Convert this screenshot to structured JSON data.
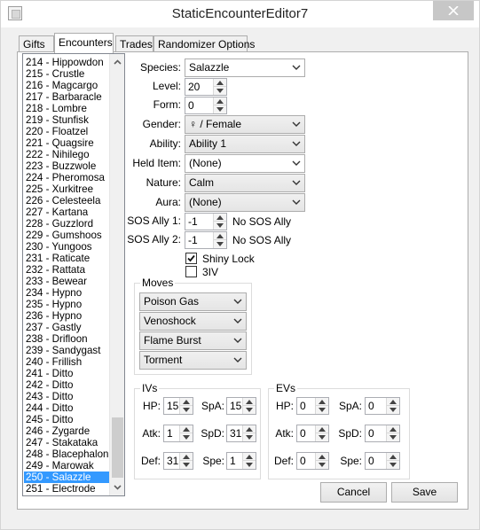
{
  "window": {
    "title": "StaticEncounterEditor7"
  },
  "tabs": [
    {
      "label": "Gifts"
    },
    {
      "label": "Encounters"
    },
    {
      "label": "Trades"
    },
    {
      "label": "Randomizer Options"
    }
  ],
  "encounter_list": {
    "items": [
      "214 - Hippowdon",
      "215 - Crustle",
      "216 - Magcargo",
      "217 - Barbaracle",
      "218 - Lombre",
      "219 - Stunfisk",
      "220 - Floatzel",
      "221 - Quagsire",
      "222 - Nihilego",
      "223 - Buzzwole",
      "224 - Pheromosa",
      "225 - Xurkitree",
      "226 - Celesteela",
      "227 - Kartana",
      "228 - Guzzlord",
      "229 - Gumshoos",
      "230 - Yungoos",
      "231 - Raticate",
      "232 - Rattata",
      "233 - Bewear",
      "234 - Hypno",
      "235 - Hypno",
      "236 - Hypno",
      "237 - Gastly",
      "238 - Drifloon",
      "239 - Sandygast",
      "240 - Frillish",
      "241 - Ditto",
      "242 - Ditto",
      "243 - Ditto",
      "244 - Ditto",
      "245 - Ditto",
      "246 - Zygarde",
      "247 - Stakataka",
      "248 - Blacephalon",
      "249 - Marowak",
      "250 - Salazzle",
      "251 - Electrode"
    ],
    "selected": "250 - Salazzle"
  },
  "form": {
    "species": {
      "label": "Species:",
      "value": "Salazzle"
    },
    "level": {
      "label": "Level:",
      "value": "20"
    },
    "form": {
      "label": "Form:",
      "value": "0"
    },
    "gender": {
      "label": "Gender:",
      "value": "♀ / Female"
    },
    "ability": {
      "label": "Ability:",
      "value": "Ability 1"
    },
    "held_item": {
      "label": "Held Item:",
      "value": "(None)"
    },
    "nature": {
      "label": "Nature:",
      "value": "Calm"
    },
    "aura": {
      "label": "Aura:",
      "value": "(None)"
    },
    "sos_ally_1": {
      "label": "SOS Ally 1:",
      "value": "-1",
      "note": "No SOS Ally"
    },
    "sos_ally_2": {
      "label": "SOS Ally 2:",
      "value": "-1",
      "note": "No SOS Ally"
    },
    "shiny_lock": {
      "label": "Shiny Lock",
      "checked": true
    },
    "three_iv": {
      "label": "3IV",
      "checked": false
    }
  },
  "moves": {
    "title": "Moves",
    "items": [
      "Poison Gas",
      "Venoshock",
      "Flame Burst",
      "Torment"
    ]
  },
  "ivs": {
    "title": "IVs",
    "hp": {
      "label": "HP:",
      "value": "15"
    },
    "atk": {
      "label": "Atk:",
      "value": "1"
    },
    "def": {
      "label": "Def:",
      "value": "31"
    },
    "spa": {
      "label": "SpA:",
      "value": "15"
    },
    "spd": {
      "label": "SpD:",
      "value": "31"
    },
    "spe": {
      "label": "Spe:",
      "value": "1"
    }
  },
  "evs": {
    "title": "EVs",
    "hp": {
      "label": "HP:",
      "value": "0"
    },
    "atk": {
      "label": "Atk:",
      "value": "0"
    },
    "def": {
      "label": "Def:",
      "value": "0"
    },
    "spa": {
      "label": "SpA:",
      "value": "0"
    },
    "spd": {
      "label": "SpD:",
      "value": "0"
    },
    "spe": {
      "label": "Spe:",
      "value": "0"
    }
  },
  "buttons": {
    "cancel": "Cancel",
    "save": "Save"
  },
  "colors": {
    "selection": "#3399ff",
    "window_bg": "#f0f0f0",
    "panel_bg": "#ffffff"
  }
}
